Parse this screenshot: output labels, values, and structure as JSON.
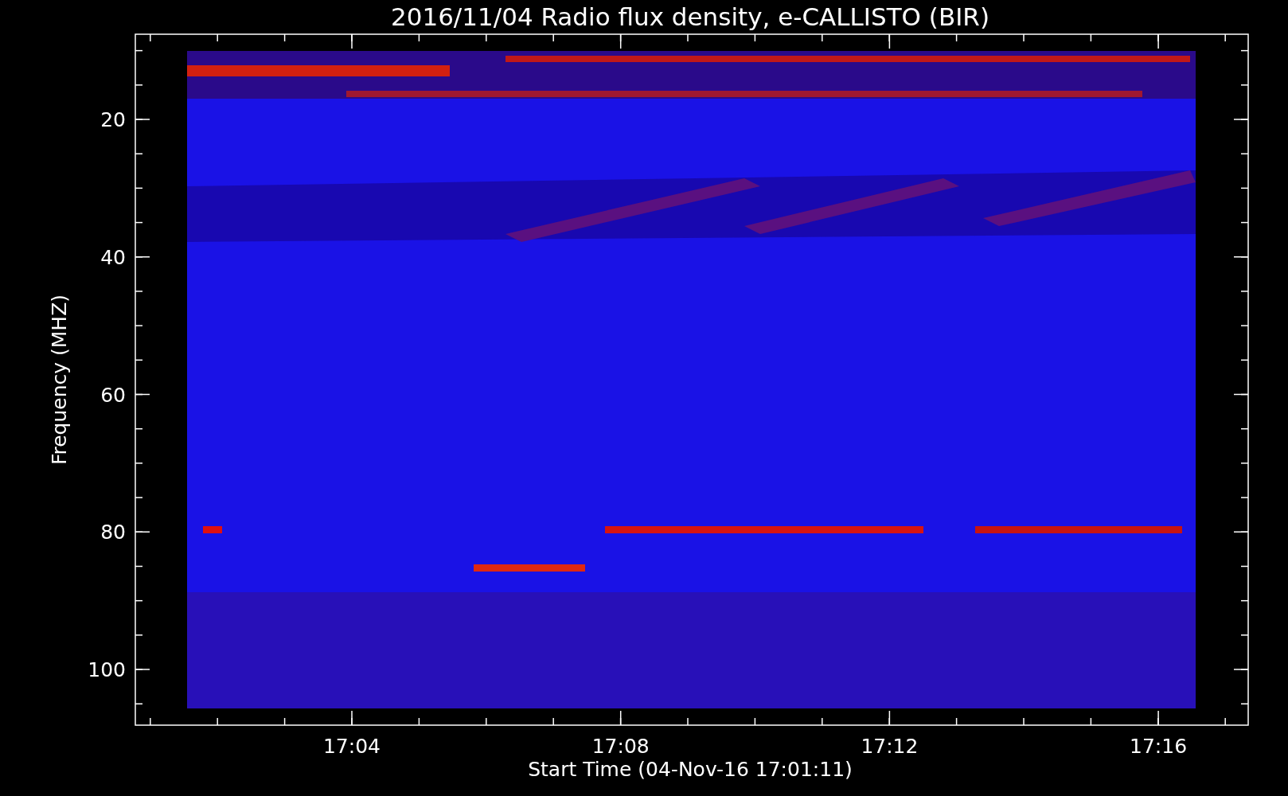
{
  "title": "2016/11/04  Radio flux density, e-CALLISTO (BIR)",
  "y_axis": {
    "label": "Frequency (MHZ)",
    "ticks": [
      "20",
      "40",
      "60",
      "80",
      "100"
    ]
  },
  "x_axis": {
    "label": "Start Time (04-Nov-16 17:01:11)",
    "ticks": [
      "17:04",
      "17:08",
      "17:12",
      "17:16"
    ]
  }
}
